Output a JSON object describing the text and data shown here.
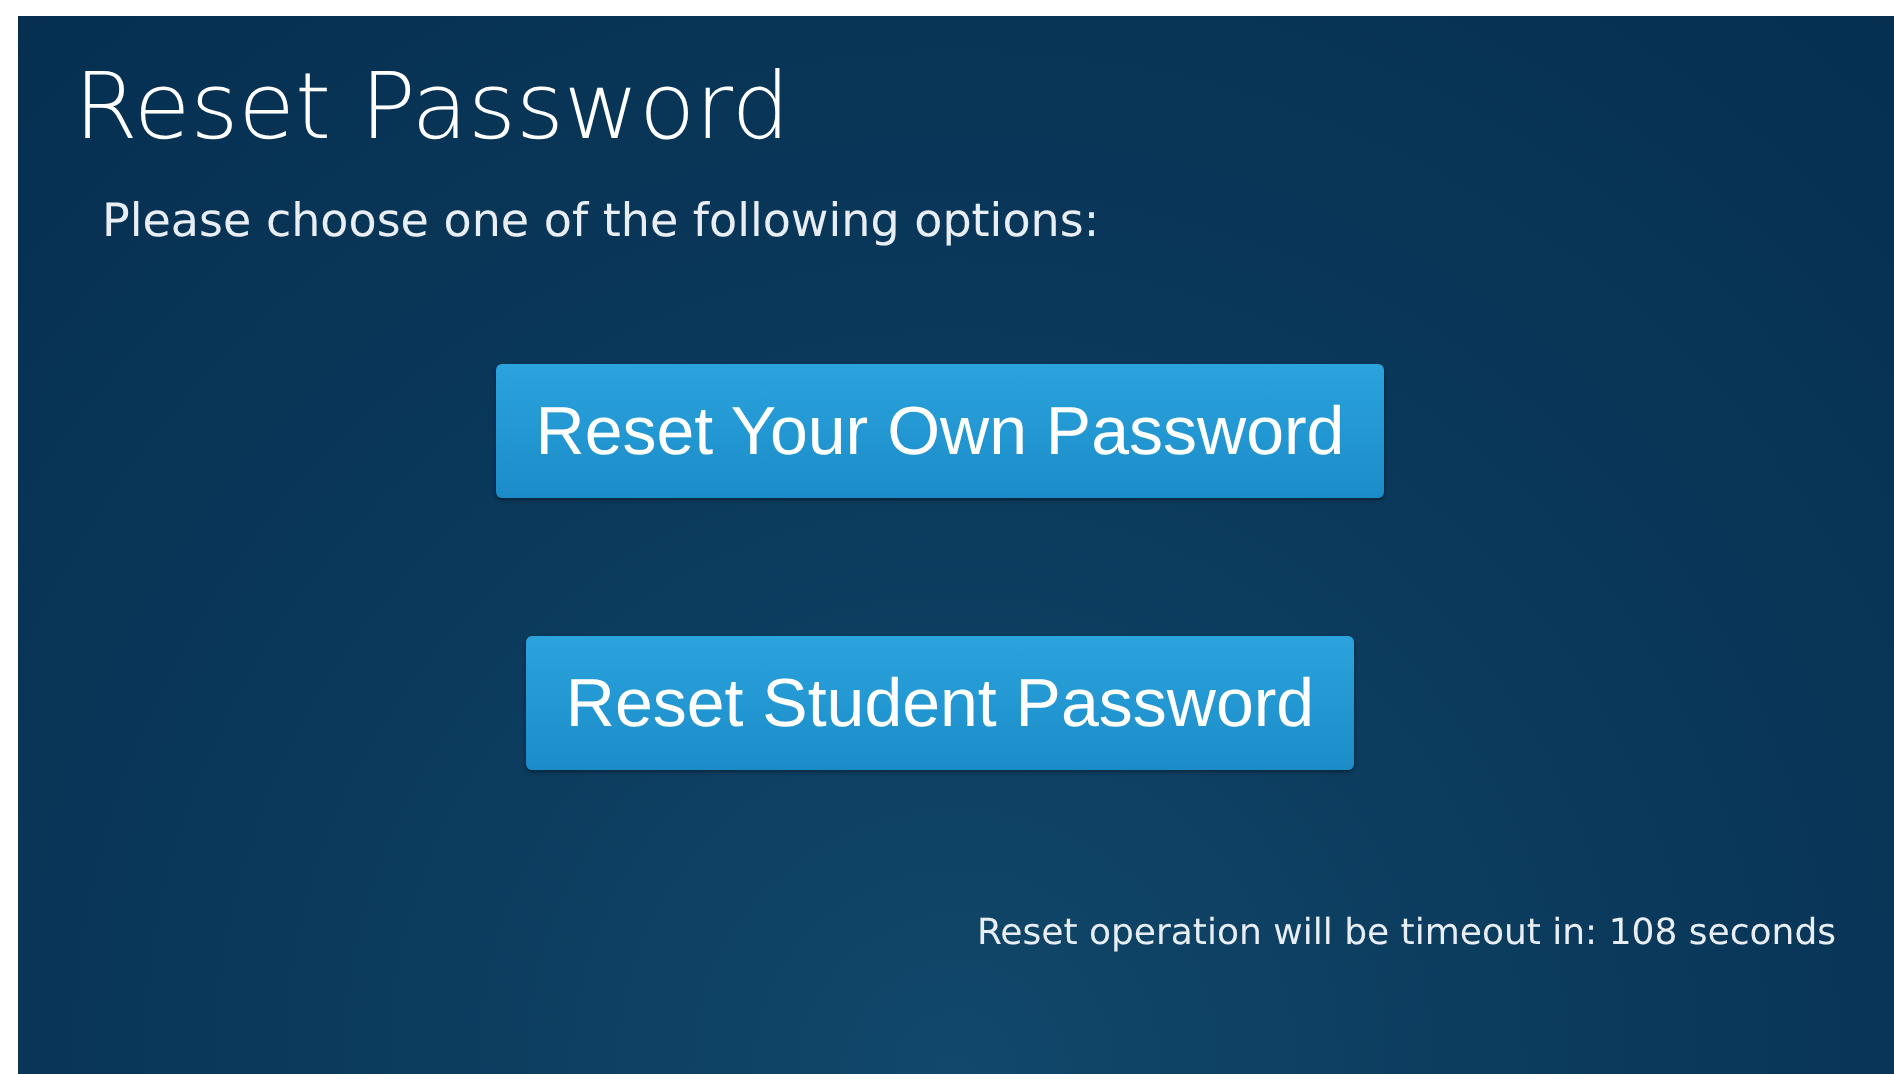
{
  "title": "Reset Password",
  "instruction": "Please choose one of the following options:",
  "buttons": [
    "Reset Your Own Password",
    "Reset Student Password"
  ],
  "timeout_message": "Reset operation will be timeout in: 108 seconds"
}
